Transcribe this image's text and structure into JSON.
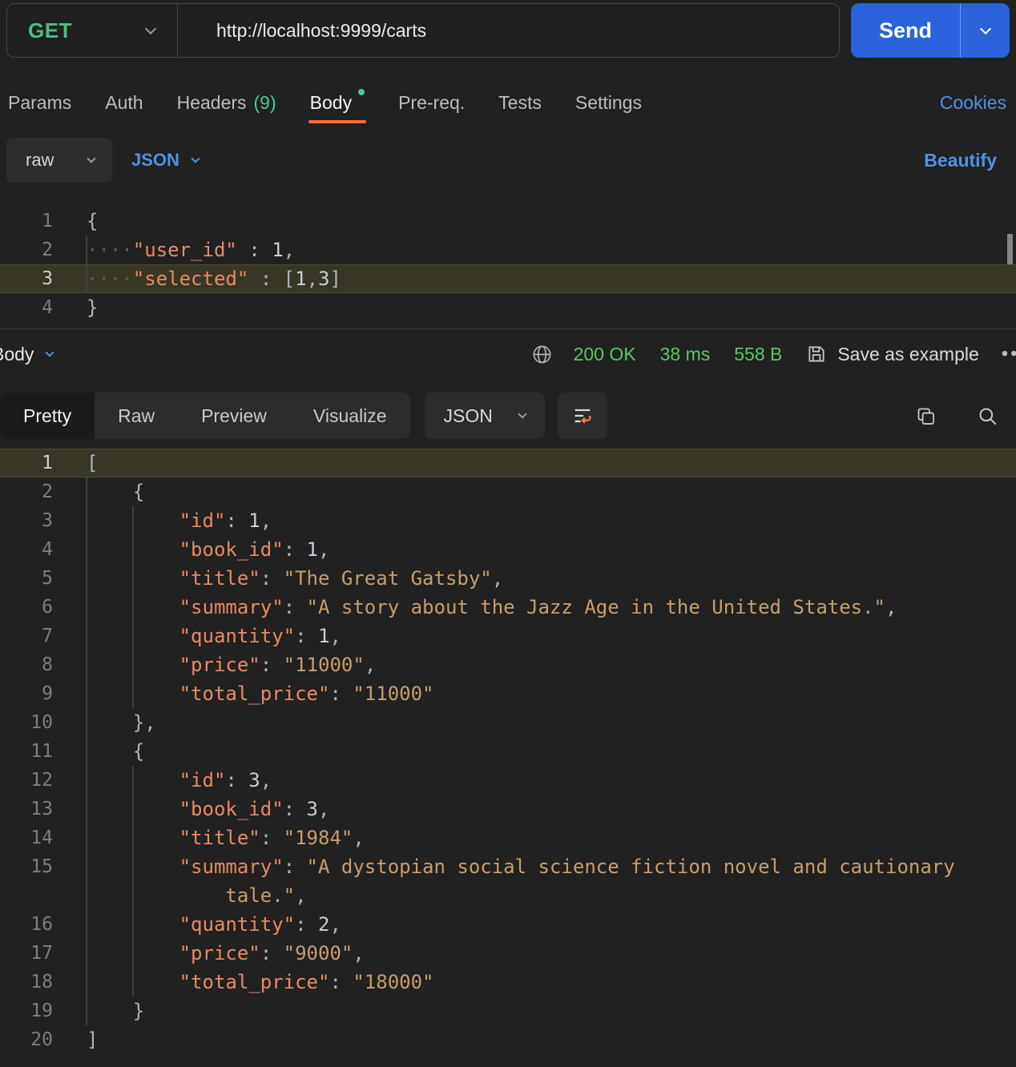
{
  "colors": {
    "accent_orange": "#ff6c37",
    "method_green": "#4fbd83",
    "status_green": "#5ec564",
    "indicator_green": "#49cc90",
    "link_blue": "#5490e2",
    "send_blue": "#2a62dc",
    "background": "#212121",
    "highlight_row": "#383726",
    "json_key": "#e88a63",
    "json_string": "#c99d6d"
  },
  "request_bar": {
    "method": "GET",
    "url": "http://localhost:9999/carts",
    "send_label": "Send"
  },
  "tabs": {
    "items": [
      {
        "label": "Params"
      },
      {
        "label": "Auth"
      },
      {
        "label": "Headers",
        "count": "(9)"
      },
      {
        "label": "Body",
        "active": true
      },
      {
        "label": "Pre-req."
      },
      {
        "label": "Tests"
      },
      {
        "label": "Settings"
      }
    ],
    "cookies": "Cookies"
  },
  "body_toolbar": {
    "raw": "raw",
    "format": "JSON",
    "beautify": "Beautify"
  },
  "request_editor": {
    "lines": [
      {
        "n": "1",
        "seg": [
          [
            "p",
            "{"
          ]
        ]
      },
      {
        "n": "2",
        "seg": [
          [
            "ws",
            "····"
          ],
          [
            "k",
            "\"user_id\""
          ],
          [
            "p",
            " : "
          ],
          [
            "n",
            "1"
          ],
          [
            "p",
            ","
          ]
        ]
      },
      {
        "n": "3",
        "hl": true,
        "seg": [
          [
            "ws",
            "····"
          ],
          [
            "k",
            "\"selected\""
          ],
          [
            "p",
            " : "
          ],
          [
            "p",
            "["
          ],
          [
            "n",
            "1"
          ],
          [
            "p",
            ","
          ],
          [
            "n",
            "3"
          ],
          [
            "p",
            "]"
          ]
        ]
      },
      {
        "n": "4",
        "seg": [
          [
            "p",
            "}"
          ]
        ]
      }
    ]
  },
  "response_meta": {
    "body_label": "Body",
    "status": "200 OK",
    "time": "38 ms",
    "size": "558 B",
    "save_label": "Save as example",
    "more_glyph": "•••"
  },
  "response_tabs": {
    "views": [
      {
        "label": "Pretty",
        "active": true
      },
      {
        "label": "Raw"
      },
      {
        "label": "Preview"
      },
      {
        "label": "Visualize"
      }
    ],
    "format": "JSON"
  },
  "response_editor": {
    "lines": [
      {
        "n": "1",
        "hl": true,
        "seg": [
          [
            "p",
            "["
          ]
        ]
      },
      {
        "n": "2",
        "seg": [
          [
            "ws",
            "    "
          ],
          [
            "p",
            "{"
          ]
        ]
      },
      {
        "n": "3",
        "seg": [
          [
            "ws",
            "        "
          ],
          [
            "k",
            "\"id\""
          ],
          [
            "p",
            ": "
          ],
          [
            "n",
            "1"
          ],
          [
            "p",
            ","
          ]
        ]
      },
      {
        "n": "4",
        "seg": [
          [
            "ws",
            "        "
          ],
          [
            "k",
            "\"book_id\""
          ],
          [
            "p",
            ": "
          ],
          [
            "n",
            "1"
          ],
          [
            "p",
            ","
          ]
        ]
      },
      {
        "n": "5",
        "seg": [
          [
            "ws",
            "        "
          ],
          [
            "k",
            "\"title\""
          ],
          [
            "p",
            ": "
          ],
          [
            "s",
            "\"The Great Gatsby\""
          ],
          [
            "p",
            ","
          ]
        ]
      },
      {
        "n": "6",
        "seg": [
          [
            "ws",
            "        "
          ],
          [
            "k",
            "\"summary\""
          ],
          [
            "p",
            ": "
          ],
          [
            "s",
            "\"A story about the Jazz Age in the United States.\""
          ],
          [
            "p",
            ","
          ]
        ]
      },
      {
        "n": "7",
        "seg": [
          [
            "ws",
            "        "
          ],
          [
            "k",
            "\"quantity\""
          ],
          [
            "p",
            ": "
          ],
          [
            "n",
            "1"
          ],
          [
            "p",
            ","
          ]
        ]
      },
      {
        "n": "8",
        "seg": [
          [
            "ws",
            "        "
          ],
          [
            "k",
            "\"price\""
          ],
          [
            "p",
            ": "
          ],
          [
            "s",
            "\"11000\""
          ],
          [
            "p",
            ","
          ]
        ]
      },
      {
        "n": "9",
        "seg": [
          [
            "ws",
            "        "
          ],
          [
            "k",
            "\"total_price\""
          ],
          [
            "p",
            ": "
          ],
          [
            "s",
            "\"11000\""
          ]
        ]
      },
      {
        "n": "10",
        "seg": [
          [
            "ws",
            "    "
          ],
          [
            "p",
            "},"
          ]
        ]
      },
      {
        "n": "11",
        "seg": [
          [
            "ws",
            "    "
          ],
          [
            "p",
            "{"
          ]
        ]
      },
      {
        "n": "12",
        "seg": [
          [
            "ws",
            "        "
          ],
          [
            "k",
            "\"id\""
          ],
          [
            "p",
            ": "
          ],
          [
            "n",
            "3"
          ],
          [
            "p",
            ","
          ]
        ]
      },
      {
        "n": "13",
        "seg": [
          [
            "ws",
            "        "
          ],
          [
            "k",
            "\"book_id\""
          ],
          [
            "p",
            ": "
          ],
          [
            "n",
            "3"
          ],
          [
            "p",
            ","
          ]
        ]
      },
      {
        "n": "14",
        "seg": [
          [
            "ws",
            "        "
          ],
          [
            "k",
            "\"title\""
          ],
          [
            "p",
            ": "
          ],
          [
            "s",
            "\"1984\""
          ],
          [
            "p",
            ","
          ]
        ]
      },
      {
        "n": "15",
        "seg": [
          [
            "ws",
            "        "
          ],
          [
            "k",
            "\"summary\""
          ],
          [
            "p",
            ": "
          ],
          [
            "s",
            "\"A dystopian social science fiction novel and cautionary"
          ]
        ],
        "wrap": [
          [
            "ws",
            "            "
          ],
          [
            "s",
            "tale.\""
          ],
          [
            "p",
            ","
          ]
        ]
      },
      {
        "n": "16",
        "seg": [
          [
            "ws",
            "        "
          ],
          [
            "k",
            "\"quantity\""
          ],
          [
            "p",
            ": "
          ],
          [
            "n",
            "2"
          ],
          [
            "p",
            ","
          ]
        ]
      },
      {
        "n": "17",
        "seg": [
          [
            "ws",
            "        "
          ],
          [
            "k",
            "\"price\""
          ],
          [
            "p",
            ": "
          ],
          [
            "s",
            "\"9000\""
          ],
          [
            "p",
            ","
          ]
        ]
      },
      {
        "n": "18",
        "seg": [
          [
            "ws",
            "        "
          ],
          [
            "k",
            "\"total_price\""
          ],
          [
            "p",
            ": "
          ],
          [
            "s",
            "\"18000\""
          ]
        ]
      },
      {
        "n": "19",
        "seg": [
          [
            "ws",
            "    "
          ],
          [
            "p",
            "}"
          ]
        ]
      },
      {
        "n": "20",
        "seg": [
          [
            "p",
            "]"
          ]
        ]
      }
    ]
  }
}
